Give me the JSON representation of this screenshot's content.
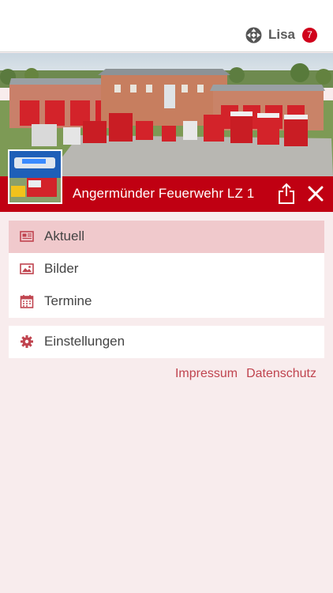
{
  "user": {
    "name": "Lisa",
    "notification_count": "7",
    "logo_icon": "app-logo-icon"
  },
  "header": {
    "title": "Angermünder Feuerwehr LZ 1",
    "share_icon": "share-icon",
    "close_icon": "close-icon"
  },
  "menu": {
    "items": [
      {
        "label": "Aktuell",
        "icon": "newspaper-icon",
        "active": true
      },
      {
        "label": "Bilder",
        "icon": "image-icon",
        "active": false
      },
      {
        "label": "Termine",
        "icon": "calendar-icon",
        "active": false
      }
    ],
    "settings": {
      "label": "Einstellungen",
      "icon": "gear-icon"
    }
  },
  "footer": {
    "impressum": "Impressum",
    "datenschutz": "Datenschutz"
  },
  "colors": {
    "accent": "#c00012",
    "background": "#f8eced",
    "active_item": "#f0c9cc",
    "link": "#c0444f",
    "badge": "#d0021b"
  }
}
